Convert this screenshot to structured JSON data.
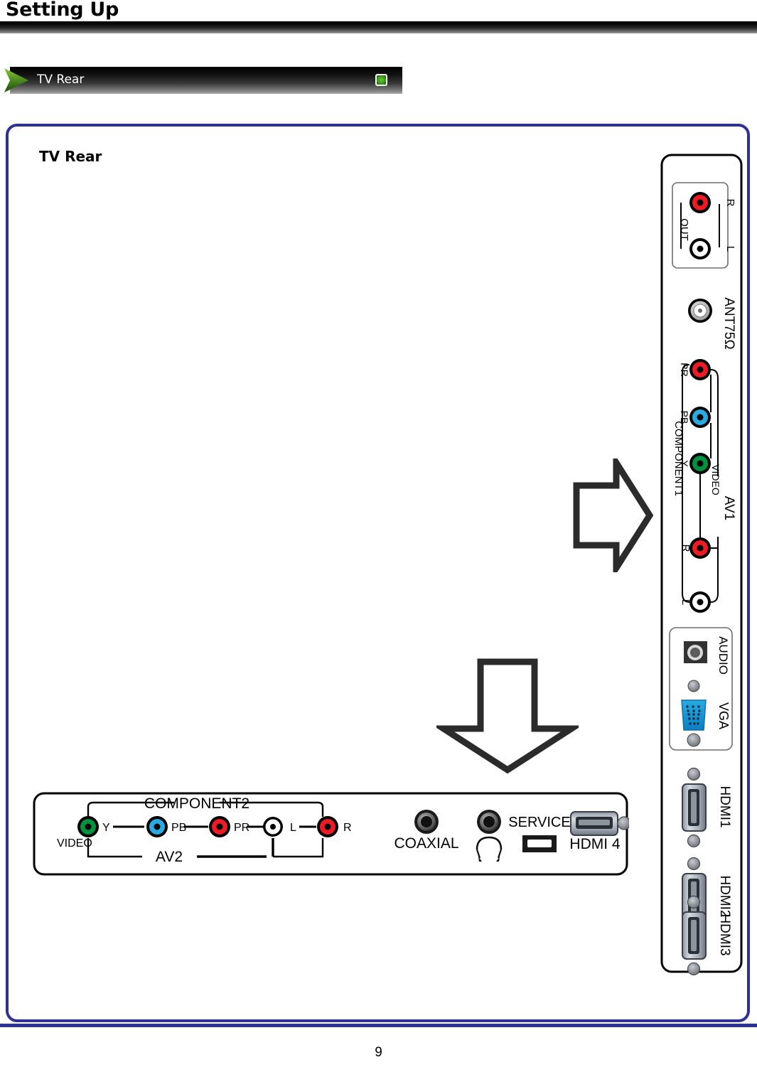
{
  "page": {
    "title": "Setting Up",
    "number": "9",
    "accent_color": "#2e3192",
    "indicator_color": "#3d9a1e"
  },
  "section": {
    "label": "TV Rear",
    "arrow_icon": "chevron-right-icon",
    "indicator_icon": "green-square-indicator-icon"
  },
  "content": {
    "heading": "TV Rear",
    "arrows": [
      {
        "name": "arrow-right-icon",
        "direction": "right"
      },
      {
        "name": "arrow-down-icon",
        "direction": "down"
      }
    ]
  },
  "side_panel": {
    "name": "tv-rear-side-connector-panel",
    "groups": [
      {
        "name": "audio-out-group",
        "label": "OUT",
        "jacks": [
          {
            "label": "R",
            "color": "#ed1c24"
          },
          {
            "label": "L",
            "color": "#ffffff"
          }
        ]
      },
      {
        "name": "antenna-group",
        "label": "ANT75Ω",
        "jacks": [
          {
            "label": "",
            "color": "#bdbdbd"
          }
        ]
      },
      {
        "name": "component1-av1-group",
        "label": "COMPONENT1",
        "sub_label": "AV1",
        "video_label": "VIDEO",
        "jacks": [
          {
            "label": "PR",
            "color": "#ed1c24"
          },
          {
            "label": "PB",
            "color": "#29abe2"
          },
          {
            "label": "Y",
            "color": "#00923f"
          },
          {
            "label": "R",
            "color": "#ed1c24"
          },
          {
            "label": "L",
            "color": "#ffffff"
          }
        ]
      },
      {
        "name": "vga-audio-group",
        "labels": [
          "AUDIO",
          "VGA"
        ]
      },
      {
        "name": "hdmi-group",
        "labels": [
          "HDMI1",
          "HDMI2",
          "HDMI3"
        ]
      }
    ]
  },
  "bottom_panel": {
    "name": "tv-rear-bottom-connector-panel",
    "component_label": "COMPONENT2",
    "av_label": "AV2",
    "video_label": "VIDEO",
    "jacks": [
      {
        "label": "Y",
        "color": "#00923f"
      },
      {
        "label": "PB",
        "color": "#29abe2"
      },
      {
        "label": "PR",
        "color": "#ed1c24"
      },
      {
        "label": "L",
        "color": "#ffffff"
      },
      {
        "label": "R",
        "color": "#ed1c24"
      }
    ],
    "coaxial_label": "COAXIAL",
    "headphone_label": "",
    "service_label": "SERVICE",
    "hdmi4_label": "HDMI 4"
  }
}
